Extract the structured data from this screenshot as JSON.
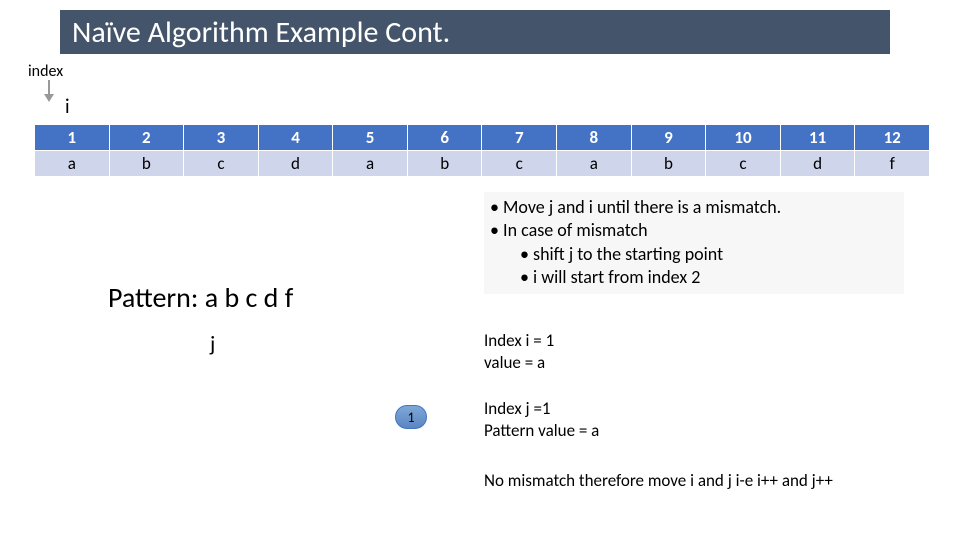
{
  "title": "Naïve Algorithm Example Cont.",
  "index_label": "index",
  "i_label": "i",
  "table": {
    "headers": [
      "1",
      "2",
      "3",
      "4",
      "5",
      "6",
      "7",
      "8",
      "9",
      "10",
      "11",
      "12"
    ],
    "values": [
      "a",
      "b",
      "c",
      "d",
      "a",
      "b",
      "c",
      "a",
      "b",
      "c",
      "d",
      "f"
    ]
  },
  "pattern_label": "Pattern: a b c d f",
  "j_label": "j",
  "pill_value": "1",
  "bullets": {
    "b1": "Move j and i until there is a mismatch.",
    "b2": "In case of mismatch",
    "b2a": "shift j to the starting point",
    "b2b": "i will start from index 2"
  },
  "status_i": {
    "line1": "Index i = 1",
    "line2": "value = a"
  },
  "status_j": {
    "line1": "Index j =1",
    "line2": "Pattern value = a"
  },
  "conclusion": "No mismatch therefore move i and j i-e i++ and j++"
}
